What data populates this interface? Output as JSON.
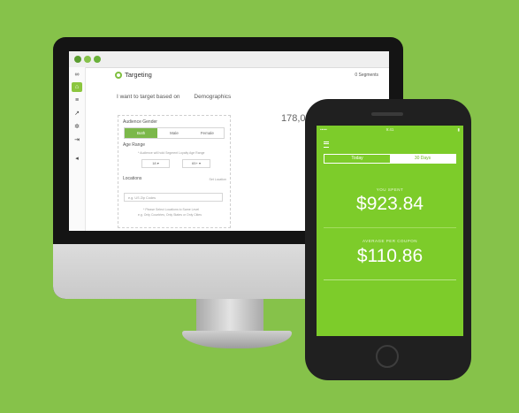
{
  "desktop_app": {
    "title": "Targeting",
    "top_right": "0 Segments",
    "target_prompt": "I want to target based on",
    "target_value": "Demographics",
    "reach_count": "178,00",
    "gender": {
      "label": "Audience Gender",
      "options": [
        "Both",
        "Male",
        "Female"
      ],
      "selected": "Both"
    },
    "age": {
      "label": "Age Range",
      "hint": "* Audience will hold Segment Loyalty Age Range",
      "min": "18 ▾",
      "max": "65+ ▾"
    },
    "locations": {
      "label": "Locations",
      "action": "Set Location",
      "placeholder": "e.g. US Zip Codes",
      "hint_line1": "* Please Select Locations to Same Level",
      "hint_line2": "e.g. Only Countries, Only States or Only Cities"
    },
    "sidebar_icons": [
      "logo-icon",
      "home-icon",
      "list-icon",
      "chart-icon",
      "gear-icon",
      "logout-icon",
      "sound-icon"
    ]
  },
  "mobile_app": {
    "status": {
      "carrier": "•••••",
      "time": "9:41",
      "battery": "▮"
    },
    "tabs": [
      "Today",
      "30 Days"
    ],
    "selected_tab": "30 Days",
    "stat1": {
      "label": "YOU SPENT",
      "value": "$923.84"
    },
    "stat2": {
      "label": "AVERAGE PER COUPON",
      "value": "$110.86"
    }
  },
  "colors": {
    "background": "#86c24a",
    "accent": "#7dcc2a",
    "device": "#141414"
  }
}
